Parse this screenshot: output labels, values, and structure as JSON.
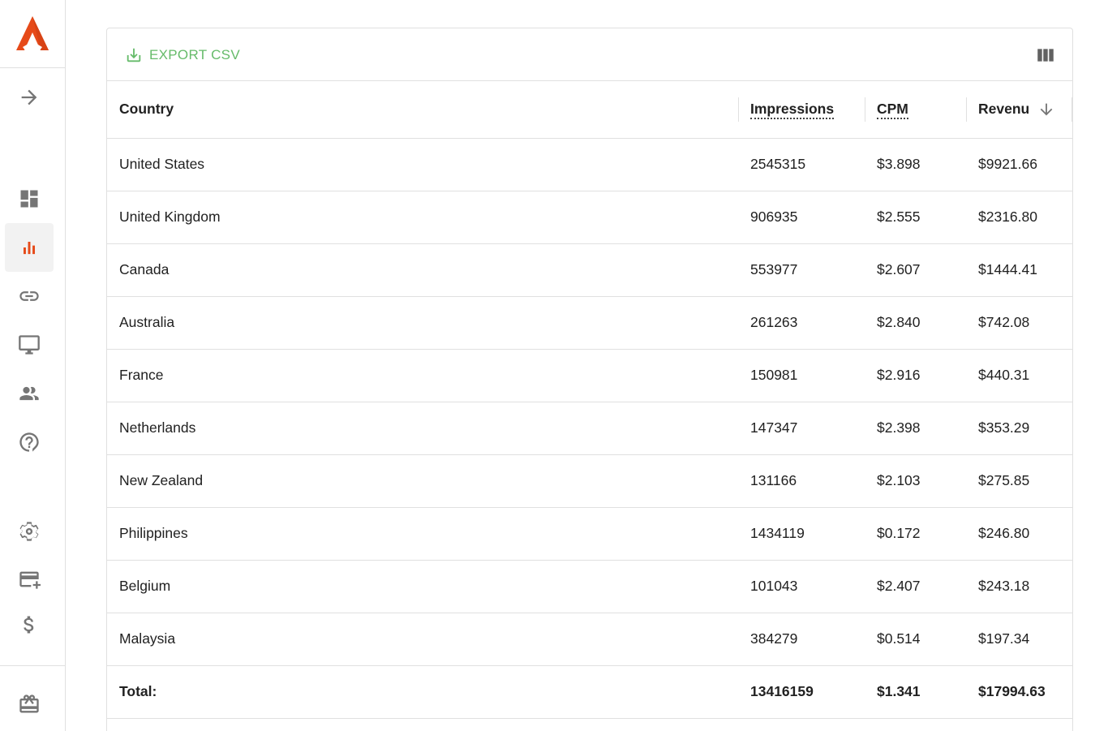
{
  "sidebar": {
    "logo_icon": "brand-a-logo",
    "brand_color": "#e64a19",
    "expand_icon": "arrow-right-icon",
    "items": [
      {
        "icon": "dashboard-icon",
        "active": false
      },
      {
        "icon": "bar-chart-icon",
        "active": true
      },
      {
        "icon": "link-icon",
        "active": false
      },
      {
        "icon": "monitor-icon",
        "active": false
      },
      {
        "icon": "people-icon",
        "active": false
      },
      {
        "icon": "help-icon",
        "active": false
      },
      {
        "icon": "settings-icon",
        "active": false
      },
      {
        "icon": "add-card-icon",
        "active": false
      },
      {
        "icon": "dollar-icon",
        "active": false
      },
      {
        "icon": "gift-icon",
        "active": false
      }
    ]
  },
  "toolbar": {
    "export_label": "EXPORT CSV",
    "export_icon": "download-icon",
    "columns_icon": "view-columns-icon",
    "accent_color": "#66bb6a"
  },
  "table": {
    "headers": {
      "country": "Country",
      "impressions": "Impressions",
      "cpm": "CPM",
      "revenue": "Revenu"
    },
    "sort_icon": "arrow-down-icon",
    "rows": [
      {
        "country": "United States",
        "impressions": "2545315",
        "cpm": "$3.898",
        "revenue": "$9921.66"
      },
      {
        "country": "United Kingdom",
        "impressions": "906935",
        "cpm": "$2.555",
        "revenue": "$2316.80"
      },
      {
        "country": "Canada",
        "impressions": "553977",
        "cpm": "$2.607",
        "revenue": "$1444.41"
      },
      {
        "country": "Australia",
        "impressions": "261263",
        "cpm": "$2.840",
        "revenue": "$742.08"
      },
      {
        "country": "France",
        "impressions": "150981",
        "cpm": "$2.916",
        "revenue": "$440.31"
      },
      {
        "country": "Netherlands",
        "impressions": "147347",
        "cpm": "$2.398",
        "revenue": "$353.29"
      },
      {
        "country": "New Zealand",
        "impressions": "131166",
        "cpm": "$2.103",
        "revenue": "$275.85"
      },
      {
        "country": "Philippines",
        "impressions": "1434119",
        "cpm": "$0.172",
        "revenue": "$246.80"
      },
      {
        "country": "Belgium",
        "impressions": "101043",
        "cpm": "$2.407",
        "revenue": "$243.18"
      },
      {
        "country": "Malaysia",
        "impressions": "384279",
        "cpm": "$0.514",
        "revenue": "$197.34"
      }
    ],
    "total": {
      "label": "Total:",
      "impressions": "13416159",
      "cpm": "$1.341",
      "revenue": "$17994.63"
    }
  }
}
